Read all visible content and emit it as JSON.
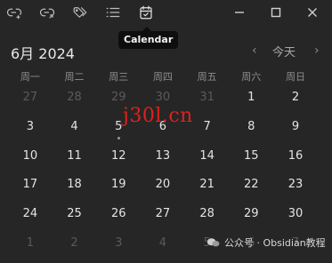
{
  "toolbar": {
    "icons": [
      "link-add-icon",
      "link-out-icon",
      "tags-icon",
      "list-icon",
      "calendar-check-icon"
    ],
    "window_controls": [
      "minimize-icon",
      "maximize-icon",
      "close-icon"
    ]
  },
  "tooltip": {
    "text": "Calendar"
  },
  "calendar": {
    "month_title": "6月 2024",
    "prev": "‹",
    "today": "今天",
    "next": "›",
    "weekdays": [
      "周一",
      "周二",
      "周三",
      "周四",
      "周五",
      "周六",
      "周日"
    ],
    "weeks": [
      [
        {
          "d": "27",
          "faded": true
        },
        {
          "d": "28",
          "faded": true
        },
        {
          "d": "29",
          "faded": true
        },
        {
          "d": "30",
          "faded": true
        },
        {
          "d": "31",
          "faded": true
        },
        {
          "d": "1"
        },
        {
          "d": "2"
        }
      ],
      [
        {
          "d": "3"
        },
        {
          "d": "4"
        },
        {
          "d": "5",
          "dot": true
        },
        {
          "d": "6"
        },
        {
          "d": "7"
        },
        {
          "d": "8"
        },
        {
          "d": "9"
        }
      ],
      [
        {
          "d": "10"
        },
        {
          "d": "11"
        },
        {
          "d": "12"
        },
        {
          "d": "13"
        },
        {
          "d": "14"
        },
        {
          "d": "15"
        },
        {
          "d": "16"
        }
      ],
      [
        {
          "d": "17"
        },
        {
          "d": "18"
        },
        {
          "d": "19"
        },
        {
          "d": "20"
        },
        {
          "d": "21"
        },
        {
          "d": "22"
        },
        {
          "d": "23"
        }
      ],
      [
        {
          "d": "24"
        },
        {
          "d": "25"
        },
        {
          "d": "26"
        },
        {
          "d": "27"
        },
        {
          "d": "28"
        },
        {
          "d": "29"
        },
        {
          "d": "30"
        }
      ],
      [
        {
          "d": "1",
          "faded": true
        },
        {
          "d": "2",
          "faded": true
        },
        {
          "d": "3",
          "faded": true
        },
        {
          "d": "4",
          "faded": true
        },
        {
          "d": "5",
          "faded": true
        },
        {
          "d": "6",
          "faded": true
        },
        {
          "d": "7",
          "faded": true
        }
      ]
    ]
  },
  "watermark": {
    "text": "j30l.cn"
  },
  "footer": {
    "text": "公众号 · Obsidian教程"
  },
  "colors": {
    "background": "#262626",
    "watermark": "#e0201a"
  }
}
